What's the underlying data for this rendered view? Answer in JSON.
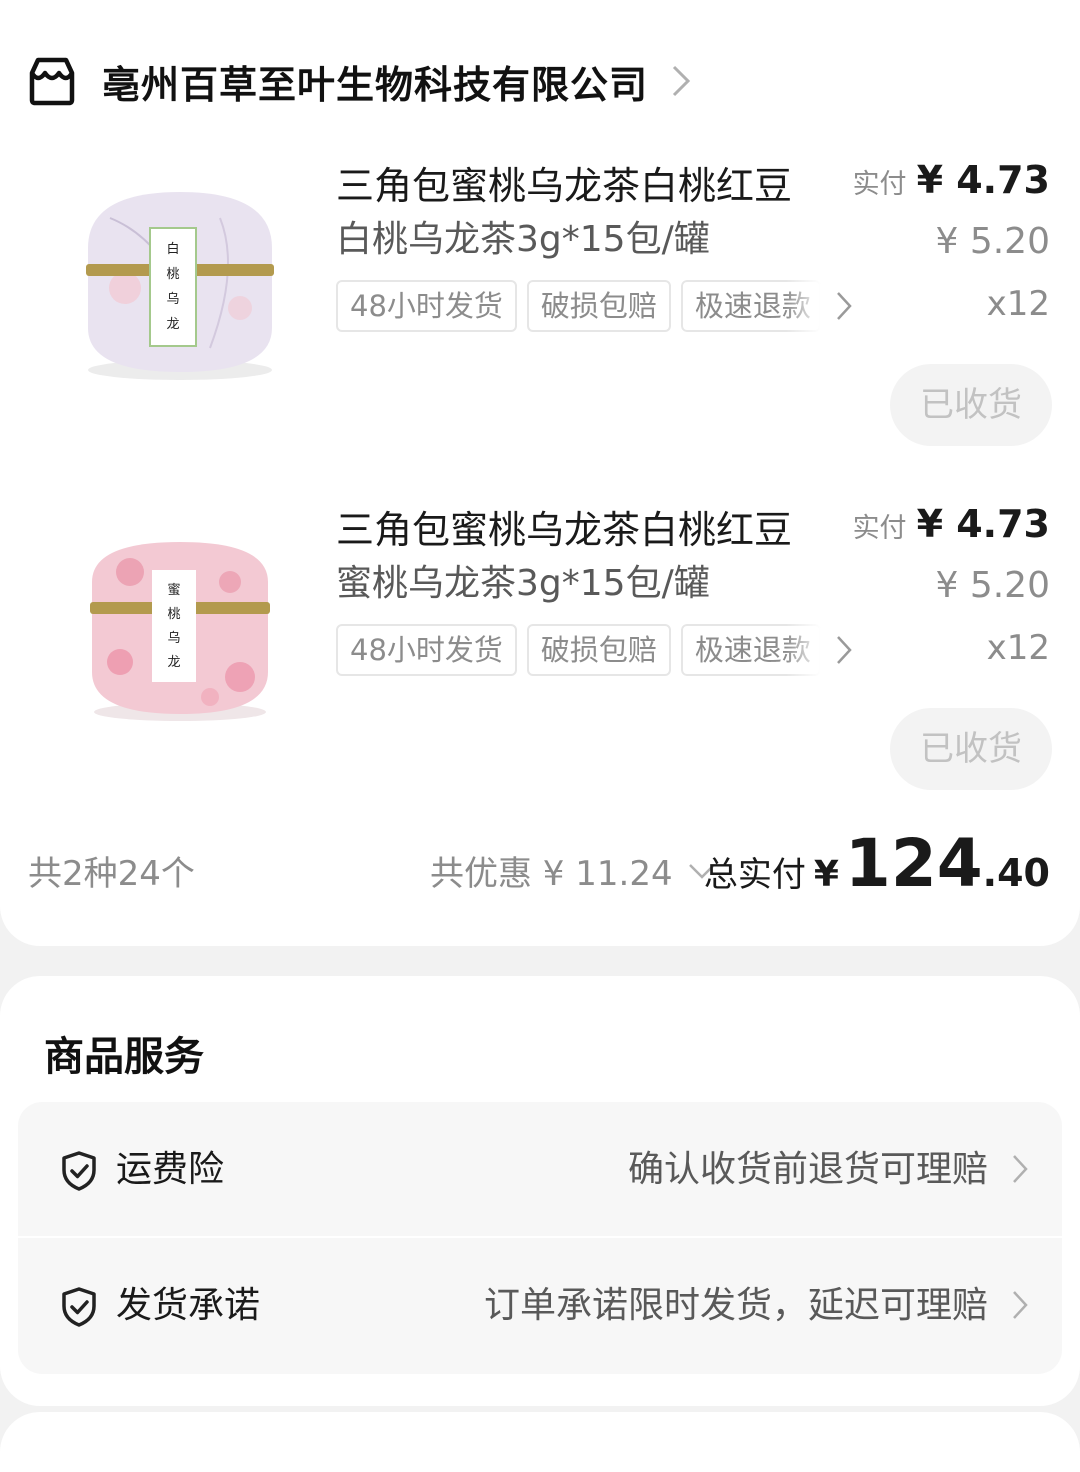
{
  "shop": {
    "name": "亳州百草至叶生物科技有限公司"
  },
  "products": [
    {
      "title": "三角包蜜桃乌龙茶白桃红豆",
      "spec": "白桃乌龙茶3g*15包/罐",
      "tags": [
        "48小时发货",
        "破损包赔",
        "极速退款"
      ],
      "price_label": "实付",
      "price": "¥ 4.73",
      "original_price": "¥ 5.20",
      "quantity": "x12",
      "status_button": "已收货",
      "can_label": "白桃乌龙茶",
      "can_color": "#e9e3f0"
    },
    {
      "title": "三角包蜜桃乌龙茶白桃红豆",
      "spec": "蜜桃乌龙茶3g*15包/罐",
      "tags": [
        "48小时发货",
        "破损包赔",
        "极速退款"
      ],
      "price_label": "实付",
      "price": "¥ 4.73",
      "original_price": "¥ 5.20",
      "quantity": "x12",
      "status_button": "已收货",
      "can_label": "蜜桃乌龙茶",
      "can_color": "#f3c9d3"
    }
  ],
  "summary": {
    "item_count": "共2种24个",
    "discount": "共优惠 ¥ 11.24",
    "total_label": "总实付",
    "total_currency": "¥",
    "total_int": "124",
    "total_dec": ".40"
  },
  "services": {
    "title": "商品服务",
    "items": [
      {
        "name": "运费险",
        "desc": "确认收货前退货可理赔"
      },
      {
        "name": "发货承诺",
        "desc": "订单承诺限时发货，延迟可理赔"
      }
    ]
  }
}
